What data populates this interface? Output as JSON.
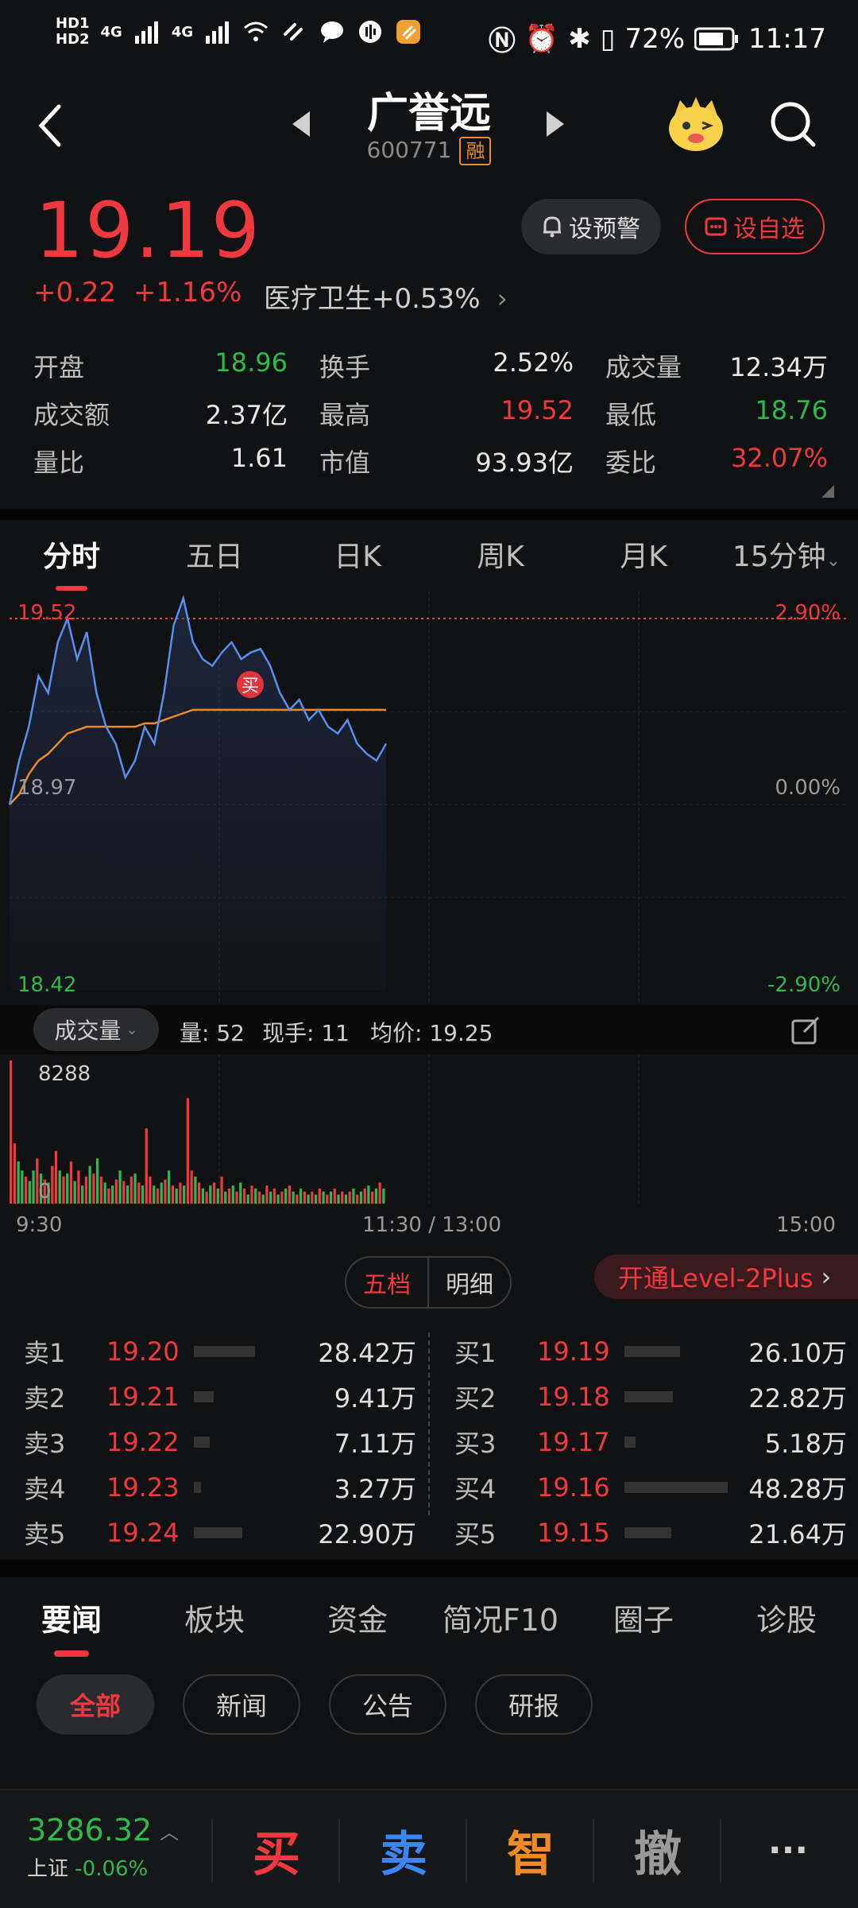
{
  "status": {
    "hd1": "HD1",
    "hd2": "HD2",
    "net1": "4G",
    "net2": "4G",
    "battery": "72%",
    "time": "11:17"
  },
  "header": {
    "name": "广誉远",
    "code": "600771",
    "tag": "融"
  },
  "quote": {
    "price": "19.19",
    "change": "+0.22",
    "change_pct": "+1.16%",
    "sector": "医疗卫生",
    "sector_pct": "+0.53%",
    "alert_btn": "设预警",
    "watch_btn": "设自选",
    "stats": [
      [
        {
          "label": "开盘",
          "value": "18.96",
          "color": "green"
        },
        {
          "label": "换手",
          "value": "2.52%",
          "color": "white"
        },
        {
          "label": "成交量",
          "value": "12.34万",
          "color": "white"
        }
      ],
      [
        {
          "label": "成交额",
          "value": "2.37亿",
          "color": "white"
        },
        {
          "label": "最高",
          "value": "19.52",
          "color": "red"
        },
        {
          "label": "最低",
          "value": "18.76",
          "color": "green"
        }
      ],
      [
        {
          "label": "量比",
          "value": "1.61",
          "color": "white"
        },
        {
          "label": "市值",
          "value": "93.93亿",
          "color": "white"
        },
        {
          "label": "委比",
          "value": "32.07%",
          "color": "red"
        }
      ]
    ]
  },
  "tabs": [
    "分时",
    "五日",
    "日K",
    "周K",
    "月K",
    "15分钟"
  ],
  "chart": {
    "price_top": "19.52",
    "pct_top": "2.90%",
    "price_mid": "18.97",
    "pct_mid": "0.00%",
    "price_bot": "18.42",
    "pct_bot": "-2.90%",
    "buy_marker": "买"
  },
  "chart_data": {
    "type": "line",
    "title": "",
    "xlabel": "",
    "ylabel": "",
    "ylim": [
      18.42,
      19.52
    ],
    "x_ticks": [
      "9:30",
      "11:30 / 13:00",
      "15:00"
    ],
    "series": [
      {
        "name": "price",
        "color": "#5b8def",
        "values": [
          18.97,
          19.1,
          19.2,
          19.35,
          19.3,
          19.45,
          19.52,
          19.4,
          19.48,
          19.3,
          19.2,
          19.15,
          19.05,
          19.1,
          19.2,
          19.15,
          19.3,
          19.5,
          19.58,
          19.45,
          19.4,
          19.38,
          19.42,
          19.45,
          19.4,
          19.42,
          19.43,
          19.38,
          19.3,
          19.25,
          19.28,
          19.22,
          19.25,
          19.2,
          19.18,
          19.22,
          19.15,
          19.12,
          19.1,
          19.15
        ]
      },
      {
        "name": "avg",
        "color": "#e98a2b",
        "values": [
          18.97,
          19.0,
          19.06,
          19.1,
          19.12,
          19.15,
          19.18,
          19.19,
          19.2,
          19.2,
          19.2,
          19.2,
          19.2,
          19.2,
          19.21,
          19.21,
          19.22,
          19.23,
          19.24,
          19.25,
          19.25,
          19.25,
          19.25,
          19.25,
          19.25,
          19.25,
          19.25,
          19.25,
          19.25,
          19.25,
          19.25,
          19.25,
          19.25,
          19.25,
          19.25,
          19.25,
          19.25,
          19.25,
          19.25,
          19.25
        ]
      }
    ]
  },
  "volume": {
    "selector": "成交量",
    "liang": "量: 52",
    "xianshou": "现手: 11",
    "junjia": "均价: 19.25",
    "max_label": "8288",
    "zero_label": "0",
    "bars": [
      95,
      40,
      28,
      22,
      18,
      15,
      22,
      30,
      20,
      16,
      14,
      25,
      35,
      22,
      18,
      20,
      28,
      15,
      22,
      12,
      18,
      25,
      20,
      30,
      18,
      14,
      10,
      12,
      16,
      22,
      15,
      12,
      18,
      20,
      14,
      12,
      50,
      18,
      12,
      10,
      14,
      16,
      22,
      12,
      10,
      14,
      12,
      70,
      22,
      18,
      14,
      10,
      8,
      12,
      14,
      10,
      18,
      8,
      10,
      12,
      8,
      14,
      10,
      6,
      12,
      10,
      8,
      6,
      12,
      8,
      10,
      6,
      8,
      10,
      12,
      8,
      6,
      10,
      8,
      6,
      8,
      6,
      10,
      8,
      6,
      8,
      10,
      6,
      8,
      6,
      8,
      10,
      6,
      8,
      10,
      12,
      8,
      10,
      14,
      10
    ],
    "bar_colors": [
      "r",
      "r",
      "g",
      "g",
      "r",
      "g",
      "g",
      "r",
      "g",
      "r",
      "g",
      "r",
      "r",
      "g",
      "r",
      "g",
      "r",
      "g",
      "r",
      "g",
      "r",
      "g",
      "r",
      "g",
      "r",
      "g",
      "r",
      "g",
      "r",
      "g",
      "r",
      "g",
      "r",
      "g",
      "r",
      "g",
      "r",
      "r",
      "g",
      "r",
      "g",
      "r",
      "g",
      "r",
      "g",
      "r",
      "g",
      "r",
      "r",
      "g",
      "r",
      "g",
      "r",
      "g",
      "r",
      "g",
      "r",
      "g",
      "r",
      "g",
      "r",
      "g",
      "r",
      "g",
      "r",
      "g",
      "r",
      "g",
      "r",
      "g",
      "r",
      "g",
      "r",
      "g",
      "r",
      "g",
      "r",
      "g",
      "r",
      "g",
      "r",
      "g",
      "r",
      "g",
      "r",
      "g",
      "r",
      "g",
      "r",
      "g",
      "r",
      "g",
      "r",
      "g",
      "r",
      "g",
      "r",
      "g",
      "r",
      "g"
    ]
  },
  "time_axis": {
    "start": "9:30",
    "mid": "11:30 / 13:00",
    "end": "15:00"
  },
  "orderbook": {
    "tab1": "五档",
    "tab2": "明细",
    "level2": "开通Level-2Plus",
    "sell": [
      {
        "label": "卖1",
        "price": "19.20",
        "vol": "28.42万",
        "ratio": 0.59
      },
      {
        "label": "卖2",
        "price": "19.21",
        "vol": "9.41万",
        "ratio": 0.19
      },
      {
        "label": "卖3",
        "price": "19.22",
        "vol": "7.11万",
        "ratio": 0.15
      },
      {
        "label": "卖4",
        "price": "19.23",
        "vol": "3.27万",
        "ratio": 0.07
      },
      {
        "label": "卖5",
        "price": "19.24",
        "vol": "22.90万",
        "ratio": 0.47
      }
    ],
    "buy": [
      {
        "label": "买1",
        "price": "19.19",
        "vol": "26.10万",
        "ratio": 0.54
      },
      {
        "label": "买2",
        "price": "19.18",
        "vol": "22.82万",
        "ratio": 0.47
      },
      {
        "label": "买3",
        "price": "19.17",
        "vol": "5.18万",
        "ratio": 0.11
      },
      {
        "label": "买4",
        "price": "19.16",
        "vol": "48.28万",
        "ratio": 1.0
      },
      {
        "label": "买5",
        "price": "19.15",
        "vol": "21.64万",
        "ratio": 0.45
      }
    ]
  },
  "news": {
    "tabs": [
      "要闻",
      "板块",
      "资金",
      "简况F10",
      "圈子",
      "诊股"
    ],
    "chips": [
      "全部",
      "新闻",
      "公告",
      "研报"
    ]
  },
  "bottom": {
    "index_value": "3286.32",
    "index_name": "上证",
    "index_pct": "-0.06%",
    "buy": "买",
    "sell": "卖",
    "smart": "智",
    "cancel": "撤",
    "more": "···"
  }
}
